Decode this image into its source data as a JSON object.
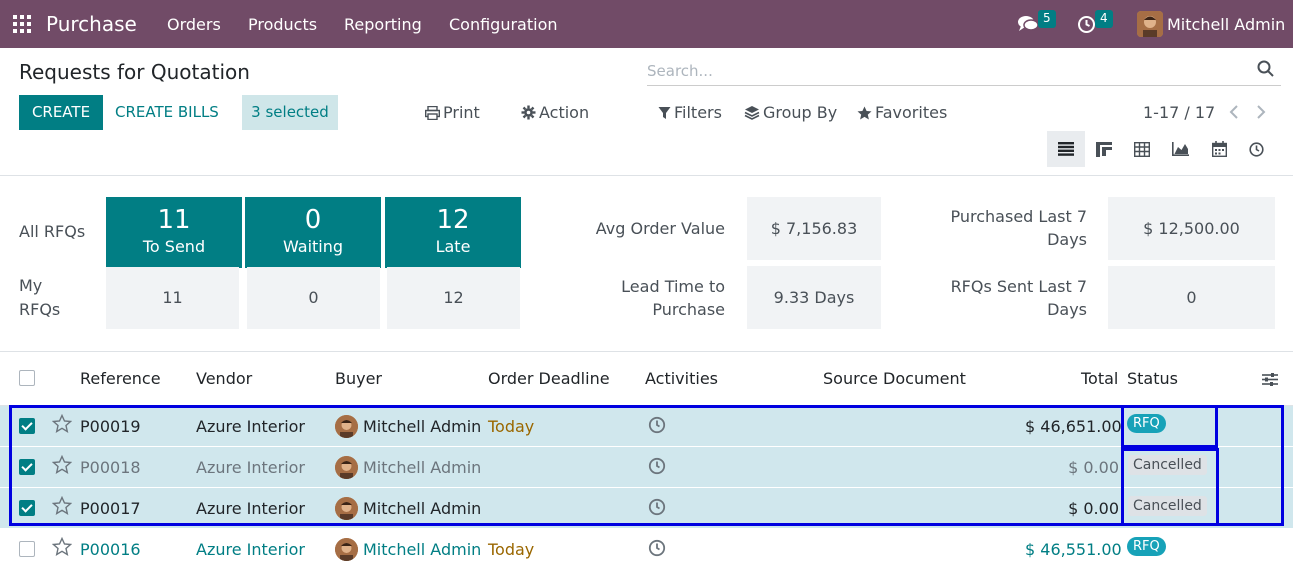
{
  "nav": {
    "app_name": "Purchase",
    "menu": [
      "Orders",
      "Products",
      "Reporting",
      "Configuration"
    ],
    "messages_count": "5",
    "activities_count": "4",
    "user_name": "Mitchell Admin",
    "icons": [
      "apps-grid-icon",
      "chat-icon",
      "clock-icon"
    ]
  },
  "control_panel": {
    "title": "Requests for Quotation",
    "search_placeholder": "Search...",
    "create_label": "CREATE",
    "create_bills_label": "CREATE BILLS",
    "selected_label": "3 selected",
    "print_label": "Print",
    "action_label": "Action",
    "filters_label": "Filters",
    "group_by_label": "Group By",
    "favorites_label": "Favorites",
    "pager": "1-17 / 17",
    "views": [
      "list",
      "kanban",
      "pivot",
      "graph",
      "calendar",
      "activity"
    ],
    "active_view": "list"
  },
  "dashboard": {
    "all_rfqs_label": "All RFQs",
    "my_rfqs_label_1": "My",
    "my_rfqs_label_2": "RFQs",
    "all": [
      {
        "value": "11",
        "label": "To Send"
      },
      {
        "value": "0",
        "label": "Waiting"
      },
      {
        "value": "12",
        "label": "Late"
      }
    ],
    "my": [
      "11",
      "0",
      "12"
    ],
    "kpis": {
      "avg_order_label": "Avg Order Value",
      "avg_order_value": "$ 7,156.83",
      "lead_time_label_1": "Lead Time to",
      "lead_time_label_2": "Purchase",
      "lead_time_value": "9.33 Days",
      "purchased_label_1": "Purchased Last 7",
      "purchased_label_2": "Days",
      "purchased_value": "$ 12,500.00",
      "sent_label_1": "RFQs Sent Last 7",
      "sent_label_2": "Days",
      "sent_value": "0"
    }
  },
  "table": {
    "headers": [
      "Reference",
      "Vendor",
      "Buyer",
      "Order Deadline",
      "Activities",
      "Source Document",
      "Total",
      "Status"
    ],
    "rows": [
      {
        "reference": "P00019",
        "vendor": "Azure Interior",
        "buyer": "Mitchell Admin",
        "deadline": "Today",
        "total": "$ 46,651.00",
        "status": "RFQ",
        "selected": true
      },
      {
        "reference": "P00018",
        "vendor": "Azure Interior",
        "buyer": "Mitchell Admin",
        "deadline": "",
        "total": "$ 0.00",
        "status": "Cancelled",
        "selected": true
      },
      {
        "reference": "P00017",
        "vendor": "Azure Interior",
        "buyer": "Mitchell Admin",
        "deadline": "",
        "total": "$ 0.00",
        "status": "Cancelled",
        "selected": true
      },
      {
        "reference": "P00016",
        "vendor": "Azure Interior",
        "buyer": "Mitchell Admin",
        "deadline": "Today",
        "total": "$ 46,551.00",
        "status": "RFQ",
        "selected": false
      }
    ]
  },
  "colors": {
    "navbar": "#714B67",
    "primary": "#017e84",
    "selected_row": "#d0e7ed",
    "highlight_box": "#0000e0"
  }
}
